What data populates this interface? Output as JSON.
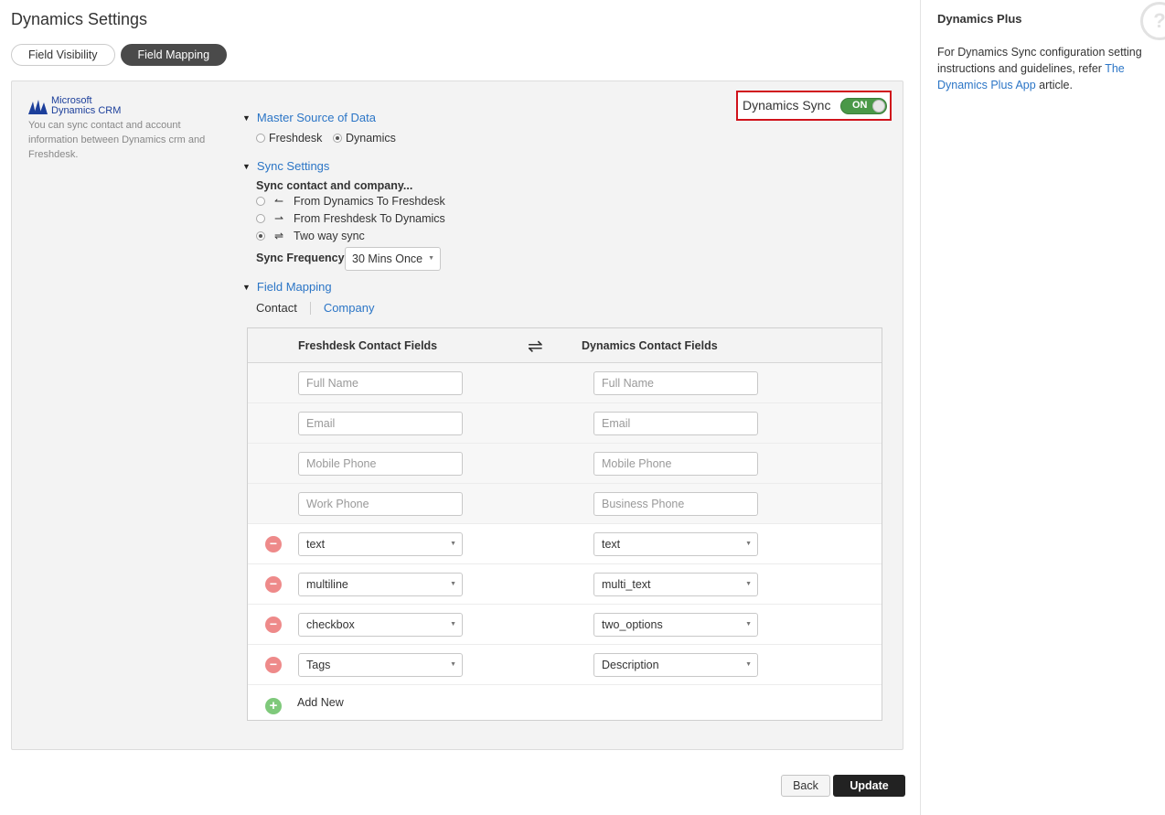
{
  "page": {
    "title": "Dynamics Settings"
  },
  "tabs": [
    {
      "label": "Field Visibility",
      "active": false
    },
    {
      "label": "Field Mapping",
      "active": true
    }
  ],
  "crm": {
    "logo_line1": "Microsoft",
    "logo_line2": "Dynamics CRM",
    "description": "You can sync contact and account information between Dynamics crm and Freshdesk."
  },
  "dynamics_sync": {
    "label": "Dynamics Sync",
    "toggle_text": "ON",
    "enabled": true
  },
  "master_source": {
    "title": "Master Source of Data",
    "options": [
      {
        "label": "Freshdesk",
        "checked": false
      },
      {
        "label": "Dynamics",
        "checked": true
      }
    ]
  },
  "sync_settings": {
    "title": "Sync Settings",
    "subtitle": "Sync contact and company...",
    "options": [
      {
        "arrow": "↼",
        "label": "From Dynamics To Freshdesk",
        "checked": false
      },
      {
        "arrow": "⇀",
        "label": "From Freshdesk To Dynamics",
        "checked": false
      },
      {
        "arrow": "⇌",
        "label": "Two way sync",
        "checked": true
      }
    ],
    "frequency_label": "Sync Frequency",
    "frequency_value": "30 Mins Once"
  },
  "field_mapping": {
    "title": "Field Mapping",
    "subtabs": {
      "contact": "Contact",
      "company": "Company"
    },
    "header_left": "Freshdesk Contact Fields",
    "header_swap": "⇌",
    "header_right": "Dynamics Contact Fields",
    "fixed_rows": [
      {
        "left": "Full Name",
        "right": "Full Name"
      },
      {
        "left": "Email",
        "right": "Email"
      },
      {
        "left": "Mobile Phone",
        "right": "Mobile Phone"
      },
      {
        "left": "Work Phone",
        "right": "Business Phone"
      }
    ],
    "custom_rows": [
      {
        "left": "text",
        "right": "text"
      },
      {
        "left": "multiline",
        "right": "multi_text"
      },
      {
        "left": "checkbox",
        "right": "two_options"
      },
      {
        "left": "Tags",
        "right": "Description"
      }
    ],
    "add_new_label": "Add New"
  },
  "actions": {
    "back": "Back",
    "update": "Update"
  },
  "sidebar": {
    "title": "Dynamics Plus",
    "text_before": "For Dynamics Sync configuration setting instructions and guidelines, refer ",
    "link_text": "The Dynamics Plus App",
    "text_after": " article.",
    "help_icon": "?"
  },
  "colors": {
    "accent_link": "#2b75c6",
    "toggle_on": "#4a9848",
    "highlight_border": "#d0121b",
    "remove": "#ee8a8a",
    "add": "#7fc97b"
  }
}
